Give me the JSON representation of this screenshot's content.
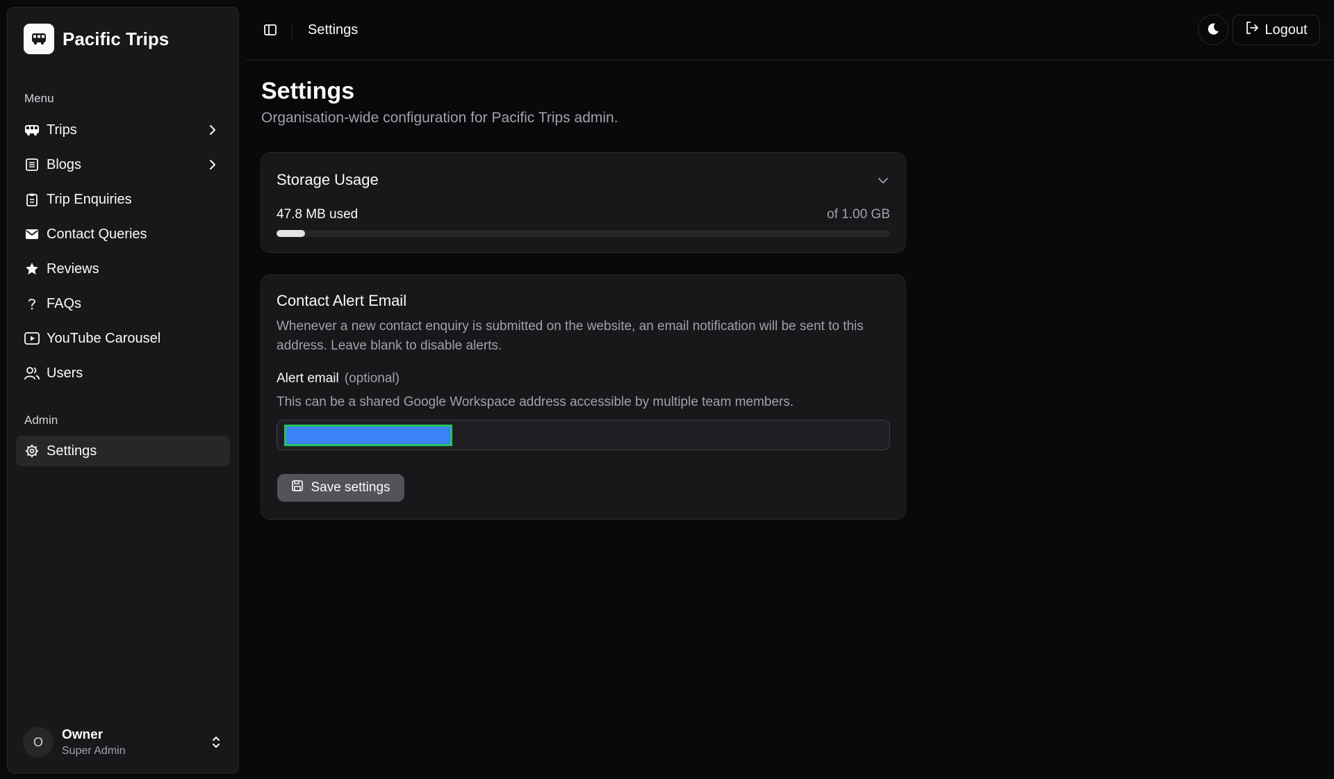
{
  "sidebar": {
    "brand": "Pacific Trips",
    "menu_label": "Menu",
    "admin_label": "Admin",
    "menu_items": [
      {
        "label": "Trips",
        "icon": "bus-icon",
        "has_submenu": true
      },
      {
        "label": "Blogs",
        "icon": "list-icon",
        "has_submenu": true
      },
      {
        "label": "Trip Enquiries",
        "icon": "clipboard-icon",
        "has_submenu": false
      },
      {
        "label": "Contact Queries",
        "icon": "mail-icon",
        "has_submenu": false
      },
      {
        "label": "Reviews",
        "icon": "star-icon",
        "has_submenu": false
      },
      {
        "label": "FAQs",
        "icon": "question-icon",
        "has_submenu": false
      },
      {
        "label": "YouTube Carousel",
        "icon": "youtube-icon",
        "has_submenu": false
      },
      {
        "label": "Users",
        "icon": "users-icon",
        "has_submenu": false
      }
    ],
    "admin_items": [
      {
        "label": "Settings",
        "icon": "gear-icon",
        "active": true
      }
    ],
    "user": {
      "initial": "O",
      "name": "Owner",
      "role": "Super Admin"
    }
  },
  "topbar": {
    "breadcrumb": "Settings",
    "logout_label": "Logout"
  },
  "page": {
    "title": "Settings",
    "subtitle": "Organisation-wide configuration for Pacific Trips admin."
  },
  "storage": {
    "title": "Storage Usage",
    "used_label": "47.8 MB used",
    "total_label": "of 1.00 GB",
    "used_fraction": 0.0467
  },
  "alert": {
    "title": "Contact Alert Email",
    "description": "Whenever a new contact enquiry is submitted on the website, an email notification will be sent to this address. Leave blank to disable alerts.",
    "field_label": "Alert email",
    "field_optional": "(optional)",
    "field_help": "This can be a shared Google Workspace address accessible by multiple team members.",
    "input_value": "",
    "save_label": "Save settings"
  },
  "colors": {
    "background": "#09090b",
    "card": "#18181b",
    "border": "#27272a",
    "selection_fill": "#3b82f6",
    "selection_outline": "#22c55e"
  }
}
